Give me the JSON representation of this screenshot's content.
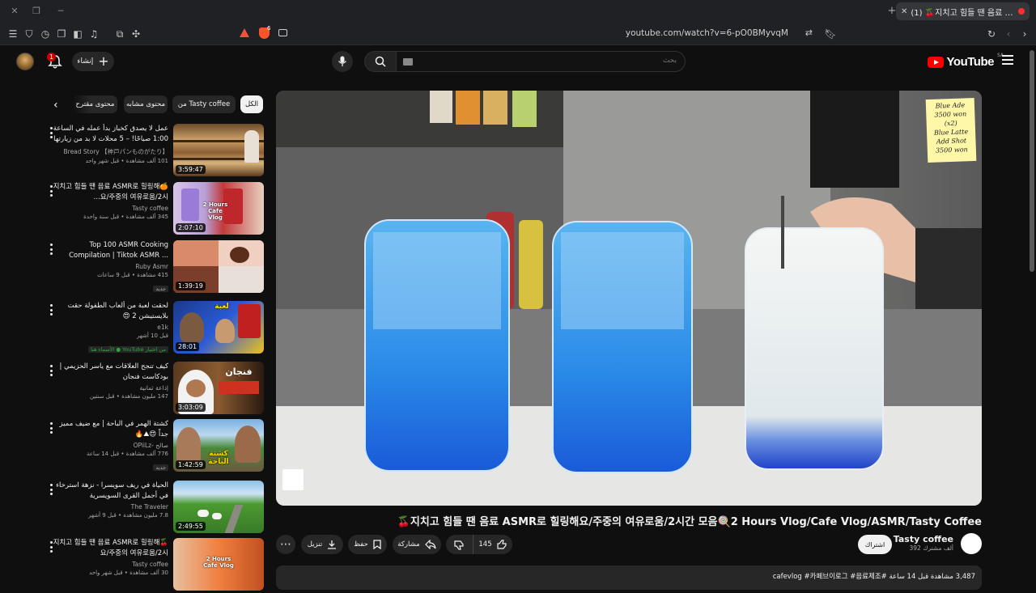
{
  "browser": {
    "tab_title": "(1) 🍒지치고 힘들 땐 음료 ASMR",
    "url": "youtube.com/watch?v=6-pO0BMyvqM",
    "shield_count": "6"
  },
  "header": {
    "logo_text": "YouTube",
    "region": "SA",
    "search_placeholder": "بحث",
    "create_label": "إنشاء",
    "notification_count": "1"
  },
  "chips": {
    "all": "الكل",
    "from_channel": "من Tasty coffee",
    "similar": "محتوى مشابه",
    "related": "محتوى مقترح"
  },
  "sidebar": {
    "items": [
      {
        "title": "عمل لا يصدق كخباز بدأ عمله في الساعة 1:00 صباحًا! – 5 محلات لا بد من زيارتها ...",
        "channel": "Bread Story 【神戸パンものがたり】",
        "views": "101 ألف مشاهدة • قبل شهر واحد",
        "duration": "3:59:47",
        "badge": ""
      },
      {
        "title": "🍊지치고 힘들 땐 음료 ASMR로 힐링해요/주중의 여유로움/2시...",
        "channel": "Tasty coffee",
        "views": "345 ألف مشاهدة • قبل سنة واحدة",
        "duration": "2:07:10",
        "badge": ""
      },
      {
        "title": "Top 100 ASMR Cooking Compilation | Tiktok ASMR ...",
        "channel": "Ruby Asmr",
        "views": "415 مشاهدة • قبل 9 ساعات",
        "duration": "1:39:19",
        "badge": "جديد"
      },
      {
        "title": "لحقت لعبة من ألعاب الطفولة حقت بلايستيشن 2 😍",
        "channel": "e1k",
        "views": "قبل 10 أشهر",
        "duration": "28:01",
        "badge": "من اختيار YouTube ● الأسماء هنا"
      },
      {
        "title": "كيف تنجح العلاقات مع ياسر الحزيمي | بودكاست فنجان",
        "channel": "إذاعة ثمانية",
        "views": "147 مليون مشاهدة • قبل سنتين",
        "duration": "3:03:09",
        "badge": ""
      },
      {
        "title": "كشتة الهمر في الباحة | مع ضيف مميز جداً 😍⛰🔥",
        "channel": "صالح -OPiiLz",
        "views": "776 ألف مشاهدة • قبل 14 ساعة",
        "duration": "1:42:59",
        "badge": "جديد"
      },
      {
        "title": "الحياة في ريف سويسرا - نزهة استرخاء في أجمل القرى السويسرية",
        "channel": "The Traveler",
        "views": "7.8 مليون مشاهدة • قبل 9 أشهر",
        "duration": "2:49:55",
        "badge": ""
      },
      {
        "title": "🍒지치고 힘들 땐 음료 ASMR로 힐링해요/주중의 여유로움/2시",
        "channel": "Tasty coffee",
        "views": "30 ألف مشاهدة • قبل شهر واحد",
        "duration": "",
        "badge": ""
      }
    ]
  },
  "thumb_text": {
    "vlog": "2 Hours Cafe Vlog",
    "fanjan": "فنجان",
    "kashta": "كشتة الباحة",
    "game": "لعبة"
  },
  "video": {
    "menu_card": [
      "Blue Ade",
      "3500 won",
      "(x2)",
      "Blue Latte",
      "Add Shot",
      "3500 won"
    ],
    "title": "🍒지치고 힘들 땐 음료 ASMR로 힐링해요/주중의 여유로움/2시간 모음🍭2 Hours Vlog/Cafe Vlog/ASMR/Tasty Coffee",
    "channel": "Tasty coffee",
    "subscribers": "392 ألف مشترك",
    "subscribe_label": "اشتراك",
    "like_count": "145",
    "share_label": "مشاركة",
    "save_label": "حفظ",
    "download_label": "تنزيل",
    "description_line": "3,487 مشاهدة قبل 14 ساعة #cafevlog #카페브이로그 #음료제조"
  },
  "colors": {
    "bg": "#0f0f0f",
    "chip": "#272727",
    "brand_red": "#ff0000",
    "drink_blue": "#1e7fe0"
  }
}
